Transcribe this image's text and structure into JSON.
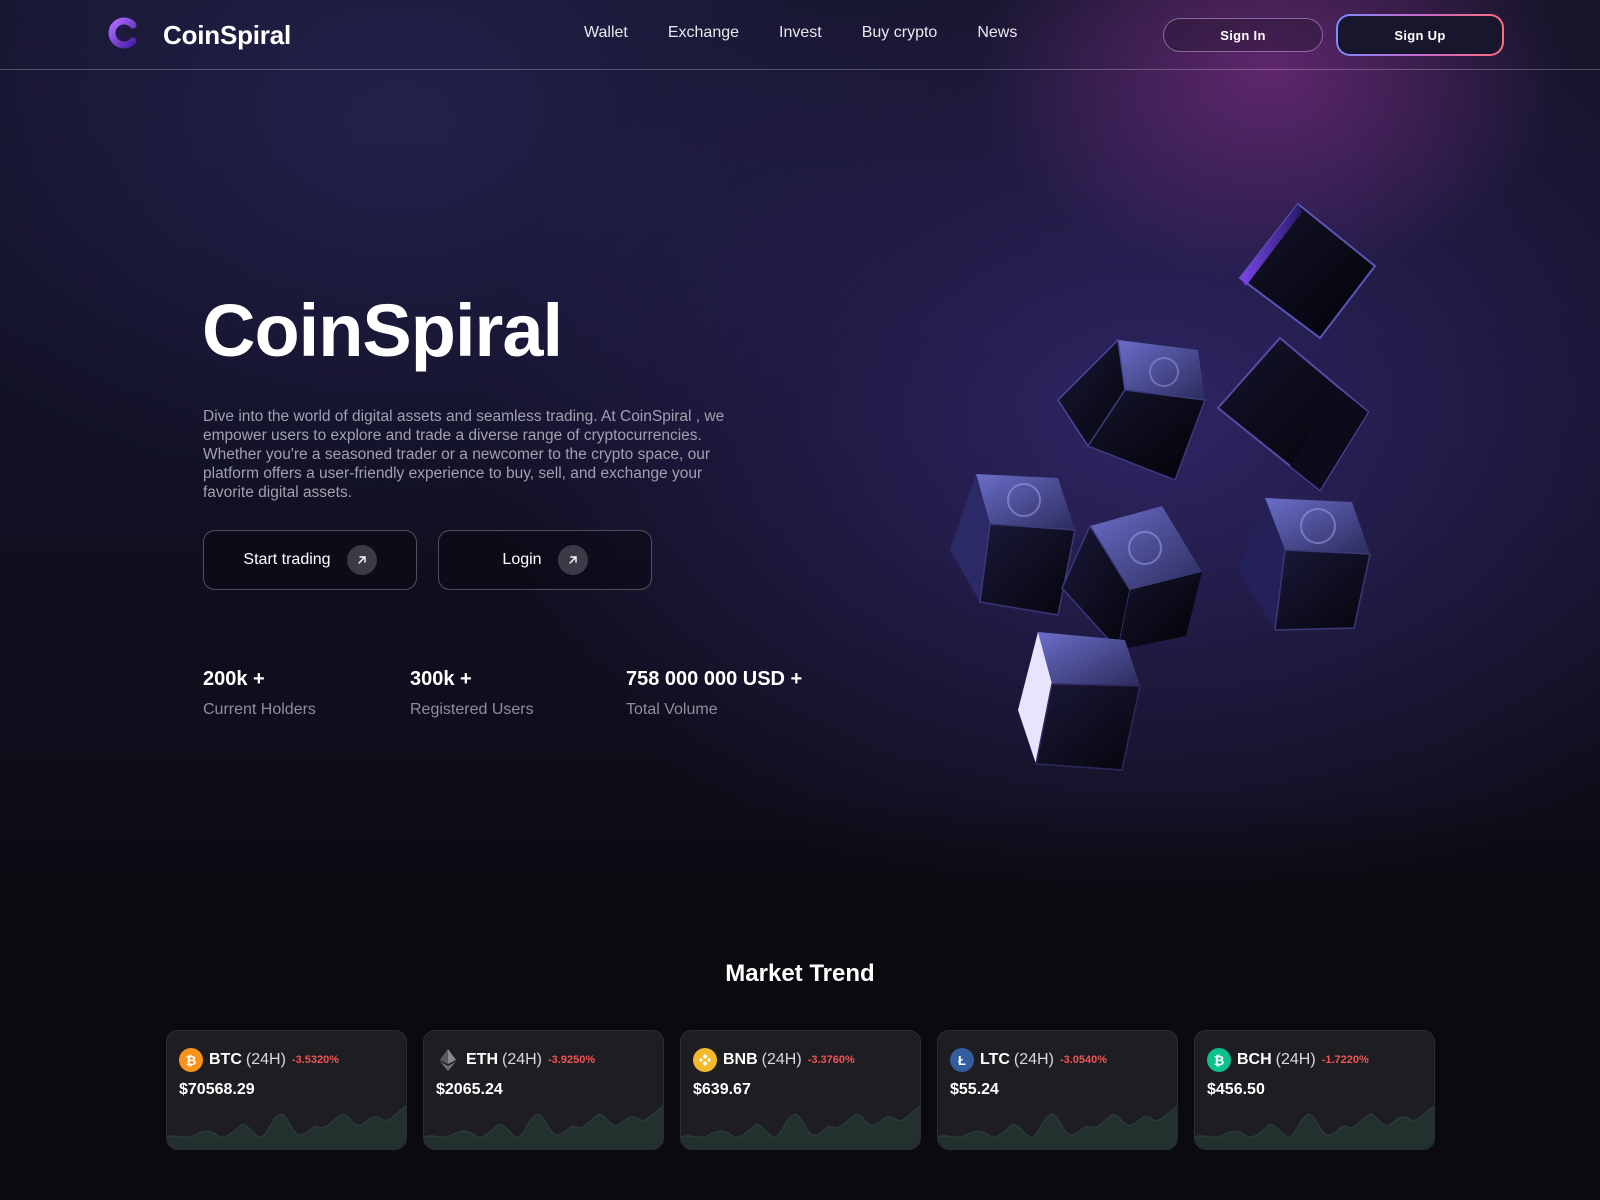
{
  "brand": {
    "name": "CoinSpiral"
  },
  "nav": {
    "links": [
      "Wallet",
      "Exchange",
      "Invest",
      "Buy crypto",
      "News"
    ],
    "signin_label": "Sign In",
    "signup_label": "Sign Up"
  },
  "hero": {
    "title": "CoinSpiral",
    "description": "Dive into the world of digital assets and seamless trading. At CoinSpiral , we empower users to explore and trade a diverse range of cryptocurrencies. Whether you're a seasoned trader or a newcomer to the crypto space, our platform offers a user-friendly experience to buy, sell, and exchange your favorite digital assets.",
    "start_label": "Start trading",
    "login_label": "Login"
  },
  "stats": [
    {
      "value": "200k +",
      "label": "Current Holders"
    },
    {
      "value": "300k +",
      "label": "Registered Users"
    },
    {
      "value": "758 000 000 USD +",
      "label": "Total Volume"
    }
  ],
  "market": {
    "title": "Market Trend",
    "cards": [
      {
        "symbol": "BTC",
        "period": "(24H)",
        "change": "-3.5320%",
        "price": "$70568.29",
        "icon": "bitcoin-icon",
        "color": "#f7931a"
      },
      {
        "symbol": "ETH",
        "period": "(24H)",
        "change": "-3.9250%",
        "price": "$2065.24",
        "icon": "ethereum-icon",
        "color": "#3c3c3d"
      },
      {
        "symbol": "BNB",
        "period": "(24H)",
        "change": "-3.3760%",
        "price": "$639.67",
        "icon": "bnb-icon",
        "color": "#f3ba2f"
      },
      {
        "symbol": "LTC",
        "period": "(24H)",
        "change": "-3.0540%",
        "price": "$55.24",
        "icon": "litecoin-icon",
        "color": "#345d9d"
      },
      {
        "symbol": "BCH",
        "period": "(24H)",
        "change": "-1.7220%",
        "price": "$456.50",
        "icon": "bitcoin-cash-icon",
        "color": "#0ac18e"
      }
    ]
  },
  "colors": {
    "accent_red": "#f05454",
    "brand_purple": "#7b3fe4"
  }
}
